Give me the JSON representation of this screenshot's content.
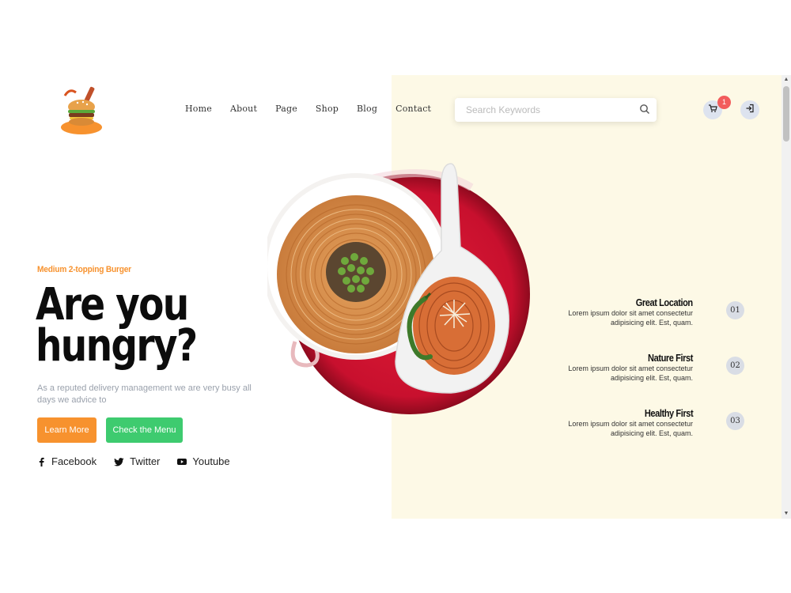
{
  "header": {
    "logo_name": "burger-logo",
    "nav": [
      {
        "label": "Home"
      },
      {
        "label": "About"
      },
      {
        "label": "Page"
      },
      {
        "label": "Shop"
      },
      {
        "label": "Blog"
      },
      {
        "label": "Contact"
      }
    ],
    "search": {
      "placeholder": "Search Keywords",
      "icon": "search-icon"
    },
    "cart": {
      "icon": "cart-icon",
      "count": "1"
    },
    "login": {
      "icon": "login-icon"
    }
  },
  "hero": {
    "subtitle": "Medium 2-topping Burger",
    "headline_line1": "Are you",
    "headline_line2": "hungry?",
    "description": "As a reputed delivery management we are very busy all days we advice to",
    "buttons": {
      "learn_more": "Learn More",
      "check_menu": "Check the Menu"
    },
    "socials": [
      {
        "label": "Facebook",
        "icon": "facebook-icon"
      },
      {
        "label": "Twitter",
        "icon": "twitter-icon"
      },
      {
        "label": "Youtube",
        "icon": "youtube-icon"
      }
    ]
  },
  "features": [
    {
      "title": "Great Location",
      "text": "Lorem ipsum dolor sit amet consectetur adipisicing elit. Est, quam.",
      "number": "01"
    },
    {
      "title": "Nature First",
      "text": "Lorem ipsum dolor sit amet consectetur adipisicing elit. Est, quam.",
      "number": "02"
    },
    {
      "title": "Healthy First",
      "text": "Lorem ipsum dolor sit amet consectetur adipisicing elit. Est, quam.",
      "number": "03"
    }
  ],
  "colors": {
    "accent_orange": "#f7922e",
    "accent_green": "#3ecb6f",
    "cream_panel": "#fdf9e6",
    "badge_red": "#f25c5c",
    "headline": "#0c0c0c"
  }
}
